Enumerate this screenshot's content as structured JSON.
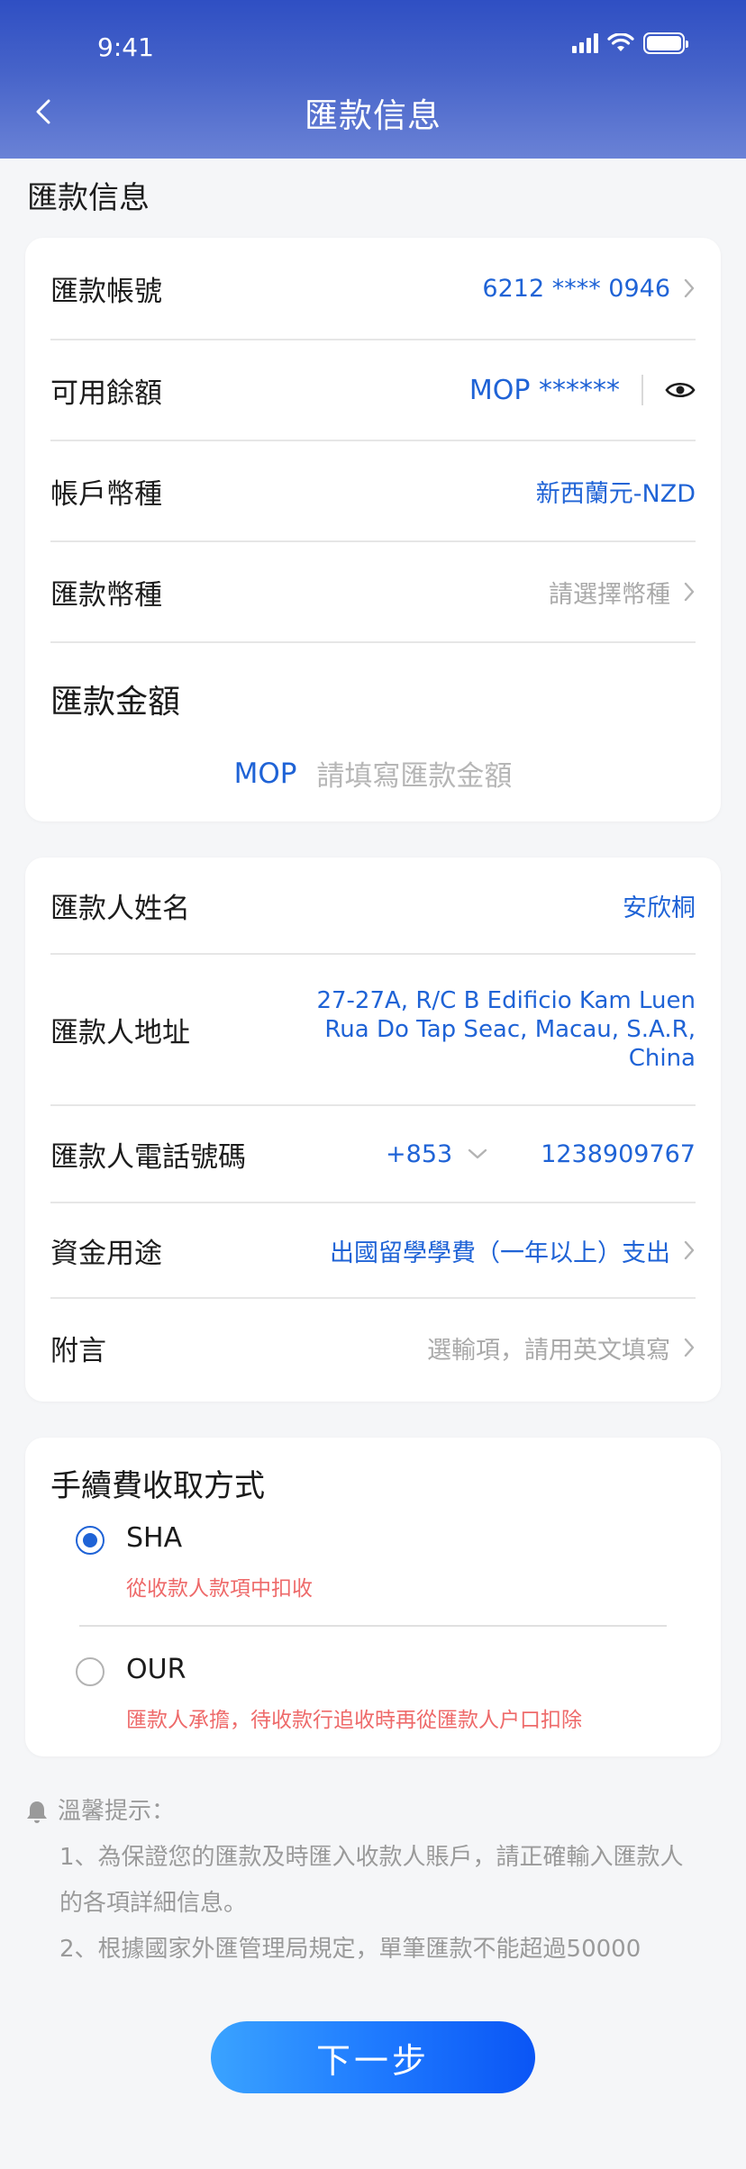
{
  "status_bar": {
    "time": "9:41"
  },
  "header": {
    "title": "匯款信息"
  },
  "section": {
    "title": "匯款信息"
  },
  "account_card": {
    "account": {
      "label": "匯款帳號",
      "value": "6212 **** 0946"
    },
    "balance": {
      "label": "可用餘額",
      "value": "MOP ******"
    },
    "account_currency": {
      "label": "帳戶幣種",
      "value": "新西蘭元-NZD"
    },
    "remit_currency": {
      "label": "匯款幣種",
      "placeholder": "請選擇幣種"
    },
    "amount": {
      "label": "匯款金額",
      "currency": "MOP",
      "placeholder": "請填寫匯款金額"
    }
  },
  "remitter_card": {
    "name": {
      "label": "匯款人姓名",
      "value": "安欣桐"
    },
    "address": {
      "label": "匯款人地址",
      "lines": [
        "27-27A, R/C B Edificio Kam Luen",
        "Rua Do Tap Seac, Macau, S.A.R,",
        "China"
      ]
    },
    "phone": {
      "label": "匯款人電話號碼",
      "code": "+853",
      "number": "1238909767"
    },
    "purpose": {
      "label": "資金用途",
      "value": "出國留學學費（一年以上）支出"
    },
    "note": {
      "label": "附言",
      "placeholder": "選輸項，請用英文填寫"
    }
  },
  "fee_card": {
    "title": "手續費收取方式",
    "options": [
      {
        "name": "SHA",
        "desc": "從收款人款項中扣收",
        "selected": true
      },
      {
        "name": "OUR",
        "desc": "匯款人承擔，待收款行追收時再從匯款人户口扣除",
        "selected": false
      }
    ]
  },
  "tips": {
    "title": "溫馨提示：",
    "lines": [
      "1、為保證您的匯款及時匯入收款人賬戶，請正確輸入匯款人",
      "的各項詳細信息。",
      "2、根據國家外匯管理局規定，單筆匯款不能超過50000"
    ]
  },
  "next_button": {
    "label": "下一步"
  },
  "colors": {
    "accent": "#1f63d6",
    "warning": "#ee6a6a",
    "header_top": "#2f4fc3",
    "header_bottom": "#6a82d6"
  },
  "icons": [
    "back-arrow-icon",
    "chevron-right-icon",
    "eye-icon",
    "chevron-down-icon",
    "bell-icon",
    "signal-icon",
    "wifi-icon",
    "battery-icon"
  ]
}
